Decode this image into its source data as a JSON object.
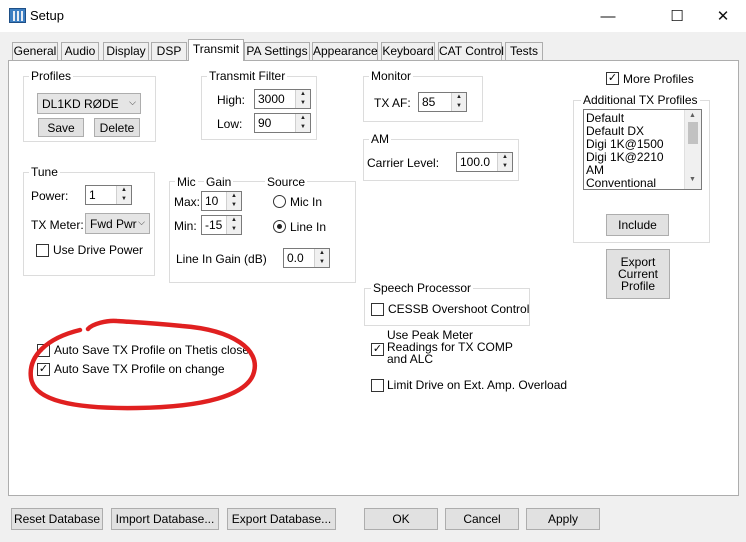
{
  "window": {
    "title": "Setup",
    "min_glyph": "—",
    "max_glyph": "☐",
    "close_glyph": "✕"
  },
  "tabs": [
    {
      "label": "General"
    },
    {
      "label": "Audio"
    },
    {
      "label": "Display"
    },
    {
      "label": "DSP"
    },
    {
      "label": "Transmit",
      "active": true
    },
    {
      "label": "PA Settings"
    },
    {
      "label": "Appearance"
    },
    {
      "label": "Keyboard"
    },
    {
      "label": "CAT Control"
    },
    {
      "label": "Tests"
    }
  ],
  "profiles": {
    "group_label": "Profiles",
    "selected": "DL1KD RØDE",
    "save_label": "Save",
    "delete_label": "Delete"
  },
  "transmit_filter": {
    "group_label": "Transmit Filter",
    "high_label": "High:",
    "high_value": "3000",
    "low_label": "Low:",
    "low_value": "90"
  },
  "monitor": {
    "group_label": "Monitor",
    "txaf_label": "TX AF:",
    "txaf_value": "85"
  },
  "am": {
    "group_label": "AM",
    "carrier_label": "Carrier Level:",
    "carrier_value": "100.0"
  },
  "more_profiles": {
    "label": "More Profiles",
    "checked": true
  },
  "additional_tx_profiles": {
    "group_label": "Additional TX Profiles",
    "items": [
      "Default",
      "Default DX",
      "Digi 1K@1500",
      "Digi 1K@2210",
      "AM",
      "Conventional"
    ],
    "include_label": "Include"
  },
  "export_profile": {
    "line1": "Export",
    "line2": "Current",
    "line3": "Profile"
  },
  "tune": {
    "group_label": "Tune",
    "power_label": "Power:",
    "power_value": "1",
    "txmeter_label": "TX Meter:",
    "txmeter_value": "Fwd Pwr",
    "use_drive_power_label": "Use Drive Power",
    "use_drive_power_checked": false
  },
  "mic": {
    "mic_label": "Mic",
    "gain_label": "Gain",
    "max_label": "Max:",
    "max_value": "10",
    "min_label": "Min:",
    "min_value": "-15",
    "source_label": "Source",
    "mic_in_label": "Mic In",
    "line_in_label": "Line In",
    "source_selected": "Line In",
    "line_in_gain_label": "Line In Gain (dB)",
    "line_in_gain_value": "0.0"
  },
  "speech_processor": {
    "group_label": "Speech Processor",
    "cessb_label": "CESSB Overshoot Control",
    "cessb_checked": false
  },
  "options": {
    "peak_meter_line1": "Use Peak Meter",
    "peak_meter_line2": "Readings for TX COMP",
    "peak_meter_line3": "and ALC",
    "peak_meter_checked": true,
    "limit_drive_label": "Limit Drive on Ext. Amp. Overload",
    "limit_drive_checked": false,
    "autosave_close_label": "Auto Save TX Profile on Thetis close",
    "autosave_close_checked": true,
    "autosave_change_label": "Auto Save TX Profile on change",
    "autosave_change_checked": true
  },
  "annotation": {
    "color": "#e02020"
  },
  "footer": {
    "reset_label": "Reset Database",
    "import_label": "Import Database...",
    "export_label": "Export Database...",
    "ok_label": "OK",
    "cancel_label": "Cancel",
    "apply_label": "Apply"
  },
  "icons": {
    "spin_up": "▲",
    "spin_down": "▼",
    "combo_arrow": "⌵",
    "check": "✓",
    "scroll_up": "▲",
    "scroll_down": "▼"
  }
}
